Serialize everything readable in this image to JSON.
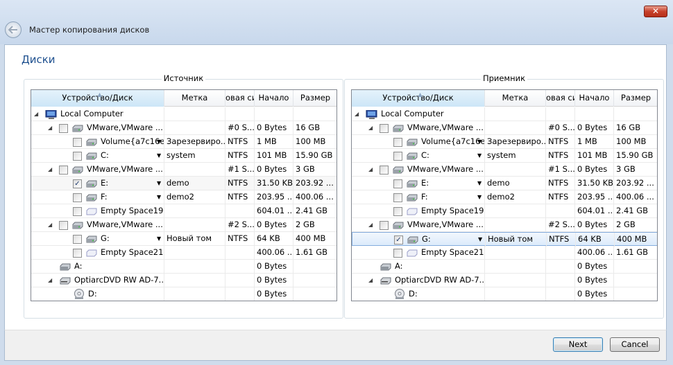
{
  "window": {
    "title": "Мастер копирования дисков",
    "close_glyph": "✕"
  },
  "page": {
    "heading": "Диски"
  },
  "columns": [
    "Устройство/Диск",
    "Метка",
    "овая си",
    "Начало",
    "Размер"
  ],
  "source": {
    "label": "Источник",
    "rows": [
      {
        "name": "Local Computer",
        "mark": "",
        "fs": "",
        "start": "",
        "size": ""
      },
      {
        "name": "VMware,VMware ...",
        "mark": "",
        "fs": "#0 S...",
        "start": "0 Bytes",
        "size": "16 GB"
      },
      {
        "name": "Volume{a7c16e...",
        "mark": "Зарезервиро...",
        "fs": "NTFS",
        "start": "1 MB",
        "size": "100 MB"
      },
      {
        "name": "C:",
        "mark": "system",
        "fs": "NTFS",
        "start": "101 MB",
        "size": "15.90 GB"
      },
      {
        "name": "VMware,VMware ...",
        "mark": "",
        "fs": "#1 S...",
        "start": "0 Bytes",
        "size": "3 GB"
      },
      {
        "name": "E:",
        "mark": "demo",
        "fs": "NTFS",
        "start": "31.50 KB",
        "size": "203.92 ..."
      },
      {
        "name": "F:",
        "mark": "demo2",
        "fs": "NTFS",
        "start": "203.95 ...",
        "size": "400.06 ..."
      },
      {
        "name": "Empty Space19",
        "mark": "",
        "fs": "",
        "start": "604.01 ...",
        "size": "2.41 GB"
      },
      {
        "name": "VMware,VMware ...",
        "mark": "",
        "fs": "#2 S...",
        "start": "0 Bytes",
        "size": "2 GB"
      },
      {
        "name": "G:",
        "mark": "Новый том",
        "fs": "NTFS",
        "start": "64 KB",
        "size": "400 MB"
      },
      {
        "name": "Empty Space21",
        "mark": "",
        "fs": "",
        "start": "400.06 ...",
        "size": "1.61 GB"
      },
      {
        "name": "A:",
        "mark": "",
        "fs": "",
        "start": "0 Bytes",
        "size": ""
      },
      {
        "name": "OptiarcDVD RW AD-7...",
        "mark": "",
        "fs": "",
        "start": "0 Bytes",
        "size": ""
      },
      {
        "name": "D:",
        "mark": "",
        "fs": "",
        "start": "0 Bytes",
        "size": ""
      }
    ]
  },
  "target": {
    "label": "Приемник",
    "rows": [
      {
        "name": "Local Computer",
        "mark": "",
        "fs": "",
        "start": "",
        "size": ""
      },
      {
        "name": "VMware,VMware ...",
        "mark": "",
        "fs": "#0 S...",
        "start": "0 Bytes",
        "size": "16 GB"
      },
      {
        "name": "Volume{a7c16e...",
        "mark": "Зарезервиро...",
        "fs": "NTFS",
        "start": "1 MB",
        "size": "100 MB"
      },
      {
        "name": "C:",
        "mark": "system",
        "fs": "NTFS",
        "start": "101 MB",
        "size": "15.90 GB"
      },
      {
        "name": "VMware,VMware ...",
        "mark": "",
        "fs": "#1 S...",
        "start": "0 Bytes",
        "size": "3 GB"
      },
      {
        "name": "E:",
        "mark": "demo",
        "fs": "NTFS",
        "start": "31.50 KB",
        "size": "203.92 ..."
      },
      {
        "name": "F:",
        "mark": "demo2",
        "fs": "NTFS",
        "start": "203.95 ...",
        "size": "400.06 ..."
      },
      {
        "name": "Empty Space19",
        "mark": "",
        "fs": "",
        "start": "604.01 ...",
        "size": "2.41 GB"
      },
      {
        "name": "VMware,VMware ...",
        "mark": "",
        "fs": "#2 S...",
        "start": "0 Bytes",
        "size": "2 GB"
      },
      {
        "name": "G:",
        "mark": "Новый том",
        "fs": "NTFS",
        "start": "64 KB",
        "size": "400 MB"
      },
      {
        "name": "Empty Space21",
        "mark": "",
        "fs": "",
        "start": "400.06 ...",
        "size": "1.61 GB"
      },
      {
        "name": "A:",
        "mark": "",
        "fs": "",
        "start": "0 Bytes",
        "size": ""
      },
      {
        "name": "OptiarcDVD RW AD-7...",
        "mark": "",
        "fs": "",
        "start": "0 Bytes",
        "size": ""
      },
      {
        "name": "D:",
        "mark": "",
        "fs": "",
        "start": "0 Bytes",
        "size": ""
      }
    ]
  },
  "buttons": {
    "next": "Next",
    "cancel": "Cancel"
  }
}
